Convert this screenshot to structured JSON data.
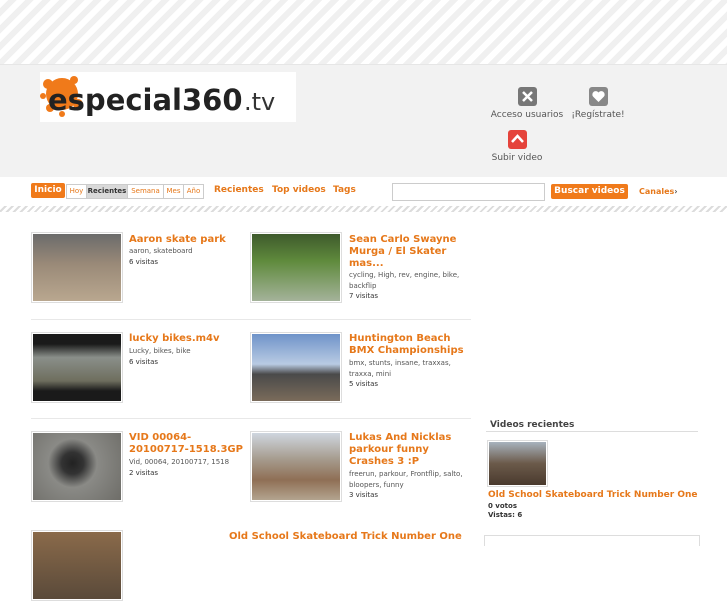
{
  "logo": {
    "text_main": "especial360",
    "text_tld": ".tv"
  },
  "header_links": [
    {
      "label": "Acceso usuarios",
      "icon": "key-icon"
    },
    {
      "label": "¡Regístrate!",
      "icon": "heart-icon"
    },
    {
      "label": "Subir video",
      "icon": "upload-icon"
    }
  ],
  "nav": {
    "inicio": "Inicio",
    "segments": [
      "Hoy",
      "Recientes",
      "Semana",
      "Mes",
      "Año"
    ],
    "active_segment": "Recientes",
    "links": [
      "Recientes",
      "Top videos",
      "Tags"
    ],
    "search_placeholder": "",
    "search_button": "Buscar videos",
    "canales": "Canales"
  },
  "videos": [
    {
      "title": "Aaron skate park",
      "tags": "aaron, skateboard",
      "visits": "6 visitas"
    },
    {
      "title": "Sean Carlo Swayne Murga / El Skater mas...",
      "tags": "cycling, High, rev, engine, bike, backflip",
      "visits": "7 visitas"
    },
    {
      "title": "lucky bikes.m4v",
      "tags": "Lucky, bikes, bike",
      "visits": "6 visitas"
    },
    {
      "title": "Huntington Beach BMX Championships",
      "tags": "bmx, stunts, insane, traxxas, traxxa, mini",
      "visits": "5 visitas"
    },
    {
      "title": "VID 00064-20100717-1518.3GP",
      "tags": "Vid, 00064, 20100717, 1518",
      "visits": "2 visitas"
    },
    {
      "title": "Lukas And Nicklas parkour funny Crashes 3 :P",
      "tags": "freerun, parkour, Frontflip, salto, bloopers, funny",
      "visits": "3 visitas"
    },
    {
      "title": "Old School Skateboard Trick Number One"
    }
  ],
  "sidebar": {
    "heading": "Videos recientes",
    "item": {
      "title": "Old School Skateboard Trick Number One",
      "votes": "0 votos",
      "views": "Vistas: 6"
    }
  },
  "colors": {
    "accent": "#f07a1a",
    "link": "#e6781a"
  }
}
